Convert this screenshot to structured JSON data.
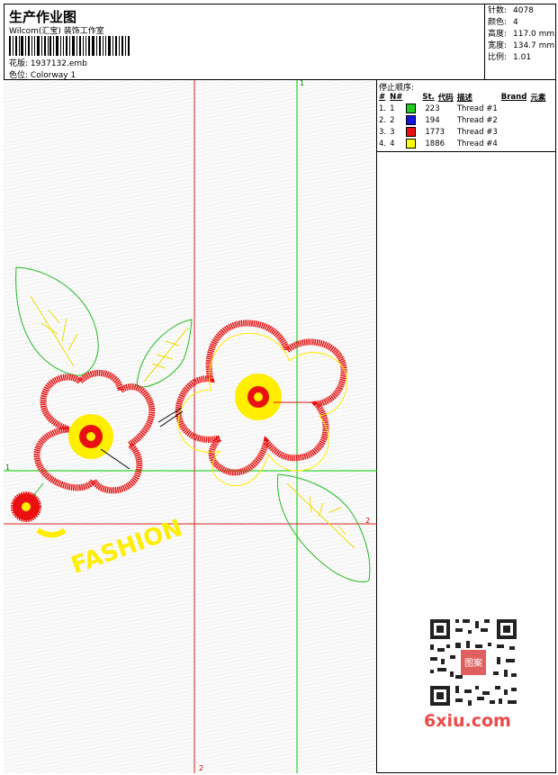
{
  "header": {
    "title": "生产作业图",
    "company": "Wilcom(汇宝) 装饰工作室",
    "design_label": "花版:",
    "design_value": "1937132.emb",
    "colorway_label": "色位:",
    "colorway_value": "Colorway 1"
  },
  "stats": [
    {
      "label": "针数:",
      "value": "4078"
    },
    {
      "label": "颜色:",
      "value": "4"
    },
    {
      "label": "高度:",
      "value": "117.0 mm"
    },
    {
      "label": "宽度:",
      "value": "134.7 mm"
    },
    {
      "label": "比例:",
      "value": "1.01"
    }
  ],
  "stop_sequence": {
    "title": "停止顺序:",
    "columns": [
      "#",
      "N#",
      "St.",
      "代码",
      "描述",
      "Brand",
      "元素"
    ],
    "rows": [
      {
        "num": "1.",
        "n": "1",
        "color": "#22cc22",
        "code": "223",
        "desc": "Thread #1"
      },
      {
        "num": "2.",
        "n": "2",
        "color": "#1414dc",
        "code": "194",
        "desc": "Thread #2"
      },
      {
        "num": "3.",
        "n": "3",
        "color": "#e81010",
        "code": "1773",
        "desc": "Thread #3"
      },
      {
        "num": "4.",
        "n": "4",
        "color": "#ffff00",
        "code": "1886",
        "desc": "Thread #4"
      }
    ]
  },
  "canvas": {
    "guide_labels": {
      "green_v": "1",
      "green_h": "1",
      "red_h": "2",
      "red_v": "2"
    },
    "embroidery_text": "FASHION",
    "colors": {
      "green_guide": "#00cc00",
      "red_guide": "#dd2222",
      "thread_red": "#e81010",
      "thread_yellow": "#ffee00",
      "thread_green": "#22bb22"
    }
  },
  "watermark": {
    "site": "6xiu.com",
    "seal_text": "图案"
  }
}
